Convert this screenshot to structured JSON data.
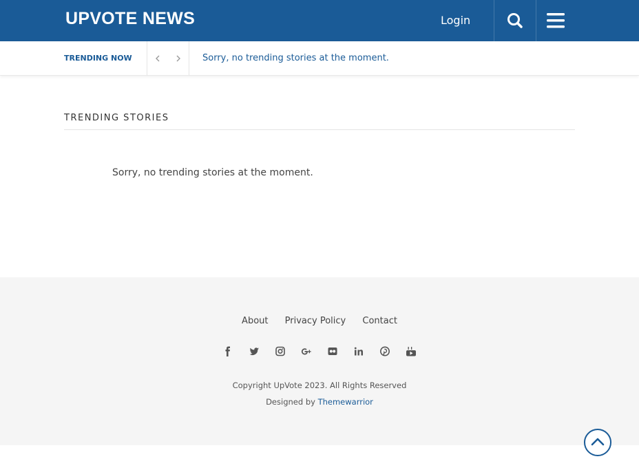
{
  "header": {
    "logo": "UPVOTE NEWS",
    "login": "Login"
  },
  "trending_bar": {
    "label": "TRENDING NOW",
    "message": "Sorry, no trending stories at the moment."
  },
  "main": {
    "section_title": "TRENDING STORIES",
    "empty_message": "Sorry, no trending stories at the moment."
  },
  "footer": {
    "links": [
      "About",
      "Privacy Policy",
      "Contact"
    ],
    "socials": [
      "facebook-icon",
      "twitter-icon",
      "instagram-icon",
      "google-plus-icon",
      "flickr-icon",
      "linkedin-icon",
      "pinterest-icon",
      "youtube-icon"
    ],
    "copyright": "Copyright UpVote 2023. All Rights Reserved",
    "designed_by_prefix": "Designed by",
    "designed_by_link": "Themewarrior"
  },
  "colors": {
    "brand": "#1a5b97",
    "footer_bg": "#f5f5f5"
  }
}
